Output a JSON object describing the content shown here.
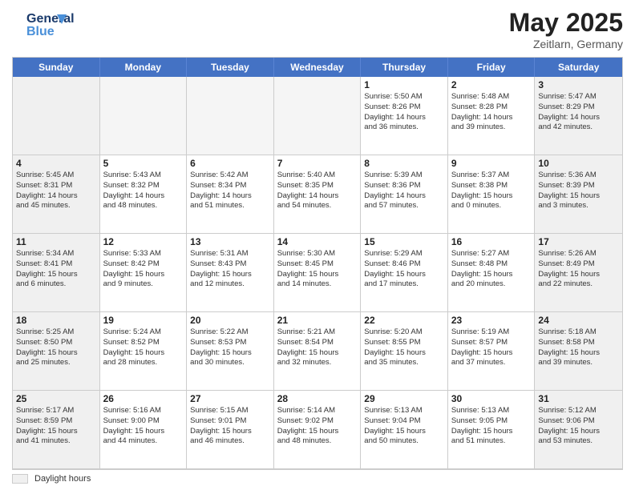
{
  "header": {
    "logo_line1": "General",
    "logo_line2": "Blue",
    "month": "May 2025",
    "location": "Zeitlarn, Germany"
  },
  "weekdays": [
    "Sunday",
    "Monday",
    "Tuesday",
    "Wednesday",
    "Thursday",
    "Friday",
    "Saturday"
  ],
  "legend": {
    "label": "Daylight hours"
  },
  "weeks": [
    [
      {
        "day": "",
        "info": "",
        "empty": true
      },
      {
        "day": "",
        "info": "",
        "empty": true
      },
      {
        "day": "",
        "info": "",
        "empty": true
      },
      {
        "day": "",
        "info": "",
        "empty": true
      },
      {
        "day": "1",
        "info": "Sunrise: 5:50 AM\nSunset: 8:26 PM\nDaylight: 14 hours\nand 36 minutes."
      },
      {
        "day": "2",
        "info": "Sunrise: 5:48 AM\nSunset: 8:28 PM\nDaylight: 14 hours\nand 39 minutes."
      },
      {
        "day": "3",
        "info": "Sunrise: 5:47 AM\nSunset: 8:29 PM\nDaylight: 14 hours\nand 42 minutes."
      }
    ],
    [
      {
        "day": "4",
        "info": "Sunrise: 5:45 AM\nSunset: 8:31 PM\nDaylight: 14 hours\nand 45 minutes."
      },
      {
        "day": "5",
        "info": "Sunrise: 5:43 AM\nSunset: 8:32 PM\nDaylight: 14 hours\nand 48 minutes."
      },
      {
        "day": "6",
        "info": "Sunrise: 5:42 AM\nSunset: 8:34 PM\nDaylight: 14 hours\nand 51 minutes."
      },
      {
        "day": "7",
        "info": "Sunrise: 5:40 AM\nSunset: 8:35 PM\nDaylight: 14 hours\nand 54 minutes."
      },
      {
        "day": "8",
        "info": "Sunrise: 5:39 AM\nSunset: 8:36 PM\nDaylight: 14 hours\nand 57 minutes."
      },
      {
        "day": "9",
        "info": "Sunrise: 5:37 AM\nSunset: 8:38 PM\nDaylight: 15 hours\nand 0 minutes."
      },
      {
        "day": "10",
        "info": "Sunrise: 5:36 AM\nSunset: 8:39 PM\nDaylight: 15 hours\nand 3 minutes."
      }
    ],
    [
      {
        "day": "11",
        "info": "Sunrise: 5:34 AM\nSunset: 8:41 PM\nDaylight: 15 hours\nand 6 minutes."
      },
      {
        "day": "12",
        "info": "Sunrise: 5:33 AM\nSunset: 8:42 PM\nDaylight: 15 hours\nand 9 minutes."
      },
      {
        "day": "13",
        "info": "Sunrise: 5:31 AM\nSunset: 8:43 PM\nDaylight: 15 hours\nand 12 minutes."
      },
      {
        "day": "14",
        "info": "Sunrise: 5:30 AM\nSunset: 8:45 PM\nDaylight: 15 hours\nand 14 minutes."
      },
      {
        "day": "15",
        "info": "Sunrise: 5:29 AM\nSunset: 8:46 PM\nDaylight: 15 hours\nand 17 minutes."
      },
      {
        "day": "16",
        "info": "Sunrise: 5:27 AM\nSunset: 8:48 PM\nDaylight: 15 hours\nand 20 minutes."
      },
      {
        "day": "17",
        "info": "Sunrise: 5:26 AM\nSunset: 8:49 PM\nDaylight: 15 hours\nand 22 minutes."
      }
    ],
    [
      {
        "day": "18",
        "info": "Sunrise: 5:25 AM\nSunset: 8:50 PM\nDaylight: 15 hours\nand 25 minutes."
      },
      {
        "day": "19",
        "info": "Sunrise: 5:24 AM\nSunset: 8:52 PM\nDaylight: 15 hours\nand 28 minutes."
      },
      {
        "day": "20",
        "info": "Sunrise: 5:22 AM\nSunset: 8:53 PM\nDaylight: 15 hours\nand 30 minutes."
      },
      {
        "day": "21",
        "info": "Sunrise: 5:21 AM\nSunset: 8:54 PM\nDaylight: 15 hours\nand 32 minutes."
      },
      {
        "day": "22",
        "info": "Sunrise: 5:20 AM\nSunset: 8:55 PM\nDaylight: 15 hours\nand 35 minutes."
      },
      {
        "day": "23",
        "info": "Sunrise: 5:19 AM\nSunset: 8:57 PM\nDaylight: 15 hours\nand 37 minutes."
      },
      {
        "day": "24",
        "info": "Sunrise: 5:18 AM\nSunset: 8:58 PM\nDaylight: 15 hours\nand 39 minutes."
      }
    ],
    [
      {
        "day": "25",
        "info": "Sunrise: 5:17 AM\nSunset: 8:59 PM\nDaylight: 15 hours\nand 41 minutes."
      },
      {
        "day": "26",
        "info": "Sunrise: 5:16 AM\nSunset: 9:00 PM\nDaylight: 15 hours\nand 44 minutes."
      },
      {
        "day": "27",
        "info": "Sunrise: 5:15 AM\nSunset: 9:01 PM\nDaylight: 15 hours\nand 46 minutes."
      },
      {
        "day": "28",
        "info": "Sunrise: 5:14 AM\nSunset: 9:02 PM\nDaylight: 15 hours\nand 48 minutes."
      },
      {
        "day": "29",
        "info": "Sunrise: 5:13 AM\nSunset: 9:04 PM\nDaylight: 15 hours\nand 50 minutes."
      },
      {
        "day": "30",
        "info": "Sunrise: 5:13 AM\nSunset: 9:05 PM\nDaylight: 15 hours\nand 51 minutes."
      },
      {
        "day": "31",
        "info": "Sunrise: 5:12 AM\nSunset: 9:06 PM\nDaylight: 15 hours\nand 53 minutes."
      }
    ]
  ]
}
